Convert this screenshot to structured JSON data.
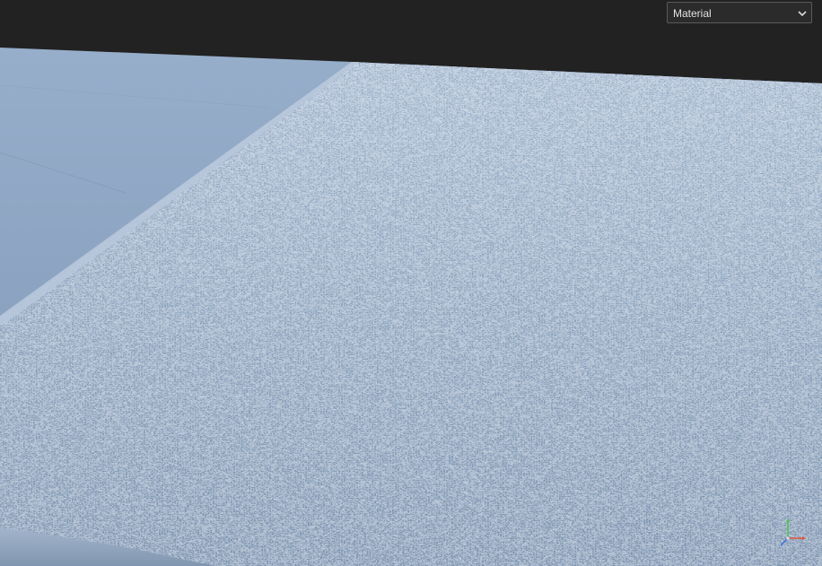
{
  "viewport": {
    "background_color": "#222222",
    "base_plane_color": "#8aa2bf",
    "material_color": "#8fa5c0"
  },
  "display_mode": {
    "selected": "Material",
    "icon": "chevron-down-icon"
  },
  "gizmo": {
    "icon": "axis-gizmo-icon",
    "axis_colors": {
      "x": "#e0533c",
      "y": "#4cc24c",
      "z": "#3f6fe0"
    }
  }
}
